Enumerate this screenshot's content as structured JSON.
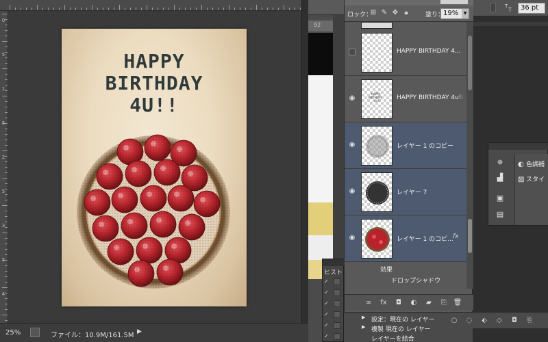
{
  "document": {
    "ruler_numbers": [
      "0",
      "5",
      "1",
      "5",
      "2",
      "5",
      "3",
      "5",
      "4"
    ],
    "card_title_lines": [
      "HAPPY",
      "BIRTHDAY",
      "4U!!"
    ]
  },
  "status_bar": {
    "zoom": "25%",
    "file_info": "ファイル：10.9M/161.5M",
    "menu_arrow": "▶"
  },
  "background_docs": {
    "tab_number": "92"
  },
  "options_bar": {
    "font_size": "36 pt",
    "font_size_icon": "font-size-icon"
  },
  "layers_panel": {
    "lock_label": "ロック：",
    "fill_label": "塗り：",
    "fill_value": "19%",
    "layers": [
      {
        "name": "HAPPY BIRTHDAY 4...",
        "visible": false,
        "selected": false,
        "thumb": "transparent"
      },
      {
        "name": "HAPPY BIRTHDAY 4u!!",
        "visible": true,
        "selected": false,
        "thumb": "text"
      },
      {
        "name": "レイヤー 1 のコピー",
        "visible": true,
        "selected": true,
        "thumb": "halftone"
      },
      {
        "name": "レイヤー 7",
        "visible": true,
        "selected": true,
        "thumb": "dark-halftone"
      },
      {
        "name": "レイヤー 1 のコピ...",
        "visible": true,
        "selected": true,
        "thumb": "tart",
        "fx": "fx"
      }
    ],
    "effects_label": "効果",
    "drop_shadow_label": "ドロップシャドウ"
  },
  "adjustments_panel": {
    "items": [
      {
        "icon": "adjustment-circle-icon",
        "label": "色調補"
      },
      {
        "icon": "style-fx-icon",
        "label": "スタイ"
      }
    ]
  },
  "history_panel": {
    "title": "ヒスト",
    "steps": [
      {
        "label": "設定：現在の レイヤー",
        "expandable": true
      },
      {
        "label": "複製 現在の レイヤー",
        "expandable": true
      },
      {
        "label": "レイヤーを結合",
        "expandable": false
      }
    ]
  },
  "colors": {
    "selected_layer": "#4d5a70",
    "panel_bg": "#595959",
    "card_bg": "#ecdcc0",
    "title_text": "#2f3a3a",
    "raspberry": "#b8232b"
  }
}
